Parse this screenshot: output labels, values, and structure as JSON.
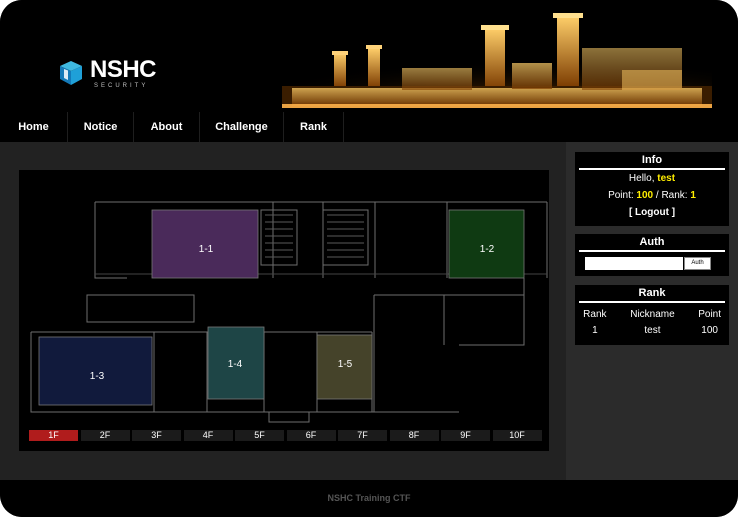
{
  "header": {
    "logo_name": "NSHC",
    "logo_sub": "SECURITY",
    "banner_icon": "industrial-plant-night-image"
  },
  "nav": {
    "items": [
      {
        "label": "Home"
      },
      {
        "label": "Notice"
      },
      {
        "label": "About"
      },
      {
        "label": "Challenge"
      },
      {
        "label": "Rank"
      }
    ]
  },
  "map": {
    "rooms": [
      {
        "label": "1-1",
        "color": "#4a2a5a"
      },
      {
        "label": "1-2",
        "color": "#0f3a12"
      },
      {
        "label": "1-3",
        "color": "#111a3c"
      },
      {
        "label": "1-4",
        "color": "#1e4546"
      },
      {
        "label": "1-5",
        "color": "#45432a"
      }
    ],
    "floors": [
      "1F",
      "2F",
      "3F",
      "4F",
      "5F",
      "6F",
      "7F",
      "8F",
      "9F",
      "10F"
    ],
    "active_floor": "1F"
  },
  "info": {
    "title": "Info",
    "hello_prefix": "Hello, ",
    "username": "test",
    "point_label": "Point: ",
    "point_value": "100",
    "rank_sep": " / Rank: ",
    "rank_value": "1",
    "logout_label": "[ Logout ]"
  },
  "auth": {
    "title": "Auth",
    "input_value": "",
    "button_label": "Auth"
  },
  "rank": {
    "title": "Rank",
    "headers": [
      "Rank",
      "Nickname",
      "Point"
    ],
    "rows": [
      [
        "1",
        "test",
        "100"
      ]
    ]
  },
  "footer": {
    "text": "NSHC Training CTF"
  },
  "colors": {
    "accent_yellow": "#ffee00",
    "active_floor": "#b01c1c"
  }
}
